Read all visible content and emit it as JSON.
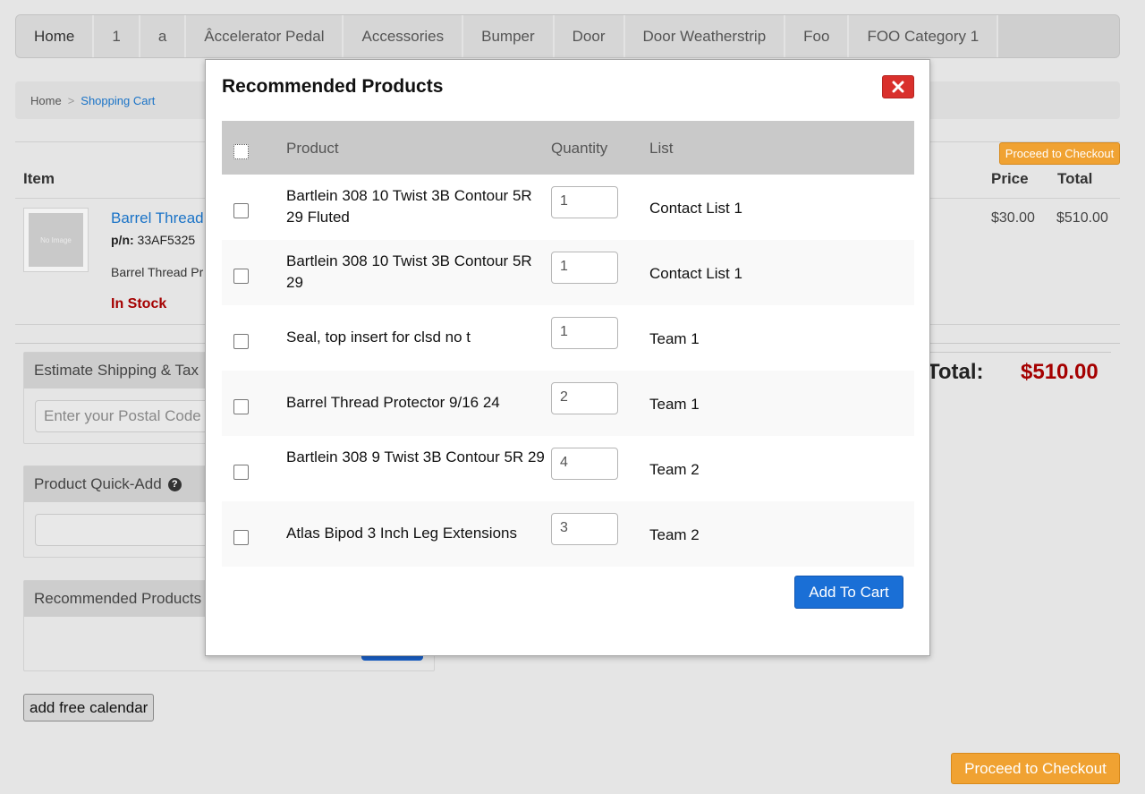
{
  "nav": {
    "items": [
      "Home",
      "1",
      "a",
      "Âccelerator Pedal",
      "Accessories",
      "Bumper",
      "Door",
      "Door Weatherstrip",
      "Foo",
      "FOO Category 1"
    ]
  },
  "breadcrumb": {
    "home": "Home",
    "separator": ">",
    "current": "Shopping Cart"
  },
  "cart": {
    "checkout_small": "Proceed to Checkout",
    "headers": {
      "item": "Item",
      "price": "Price",
      "total": "Total"
    },
    "item": {
      "thumb_text": "No Image",
      "name": "Barrel Thread",
      "pn_label": "p/n:",
      "pn_value": "33AF5325",
      "desc": "Barrel Thread Pr",
      "stock": "In Stock",
      "price": "$30.00",
      "total": "$510.00"
    },
    "grand_total_label": "Total:",
    "grand_total_value": "$510.00",
    "checkout_large": "Proceed to Checkout"
  },
  "shipping": {
    "title": "Estimate Shipping & Tax",
    "placeholder": "Enter your Postal Code"
  },
  "quick_add": {
    "title": "Product Quick-Add",
    "help": "?"
  },
  "recommended_panel": {
    "title": "Recommended Products"
  },
  "calendar_button": "add free calendar",
  "modal": {
    "title": "Recommended Products",
    "headers": {
      "product": "Product",
      "quantity": "Quantity",
      "list": "List"
    },
    "rows": [
      {
        "product": "Bartlein 308 10 Twist 3B Contour 5R 29 Fluted",
        "qty": "1",
        "list": "Contact List 1"
      },
      {
        "product": "Bartlein 308 10 Twist 3B Contour 5R 29",
        "qty": "1",
        "list": "Contact List 1"
      },
      {
        "product": "Seal, top insert for clsd no t",
        "qty": "1",
        "list": "Team 1"
      },
      {
        "product": "Barrel Thread Protector 9/16 24",
        "qty": "2",
        "list": "Team 1"
      },
      {
        "product": "Bartlein 308 9 Twist 3B Contour 5R 29",
        "qty": "4",
        "list": "Team 2"
      },
      {
        "product": "Atlas Bipod 3 Inch Leg Extensions",
        "qty": "3",
        "list": "Team 2"
      }
    ],
    "add_to_cart": "Add To Cart"
  },
  "colors": {
    "accent_blue": "#1a6fd6",
    "checkout_orange": "#f0a232",
    "price_red": "#a50000",
    "close_red": "#d9302c"
  }
}
